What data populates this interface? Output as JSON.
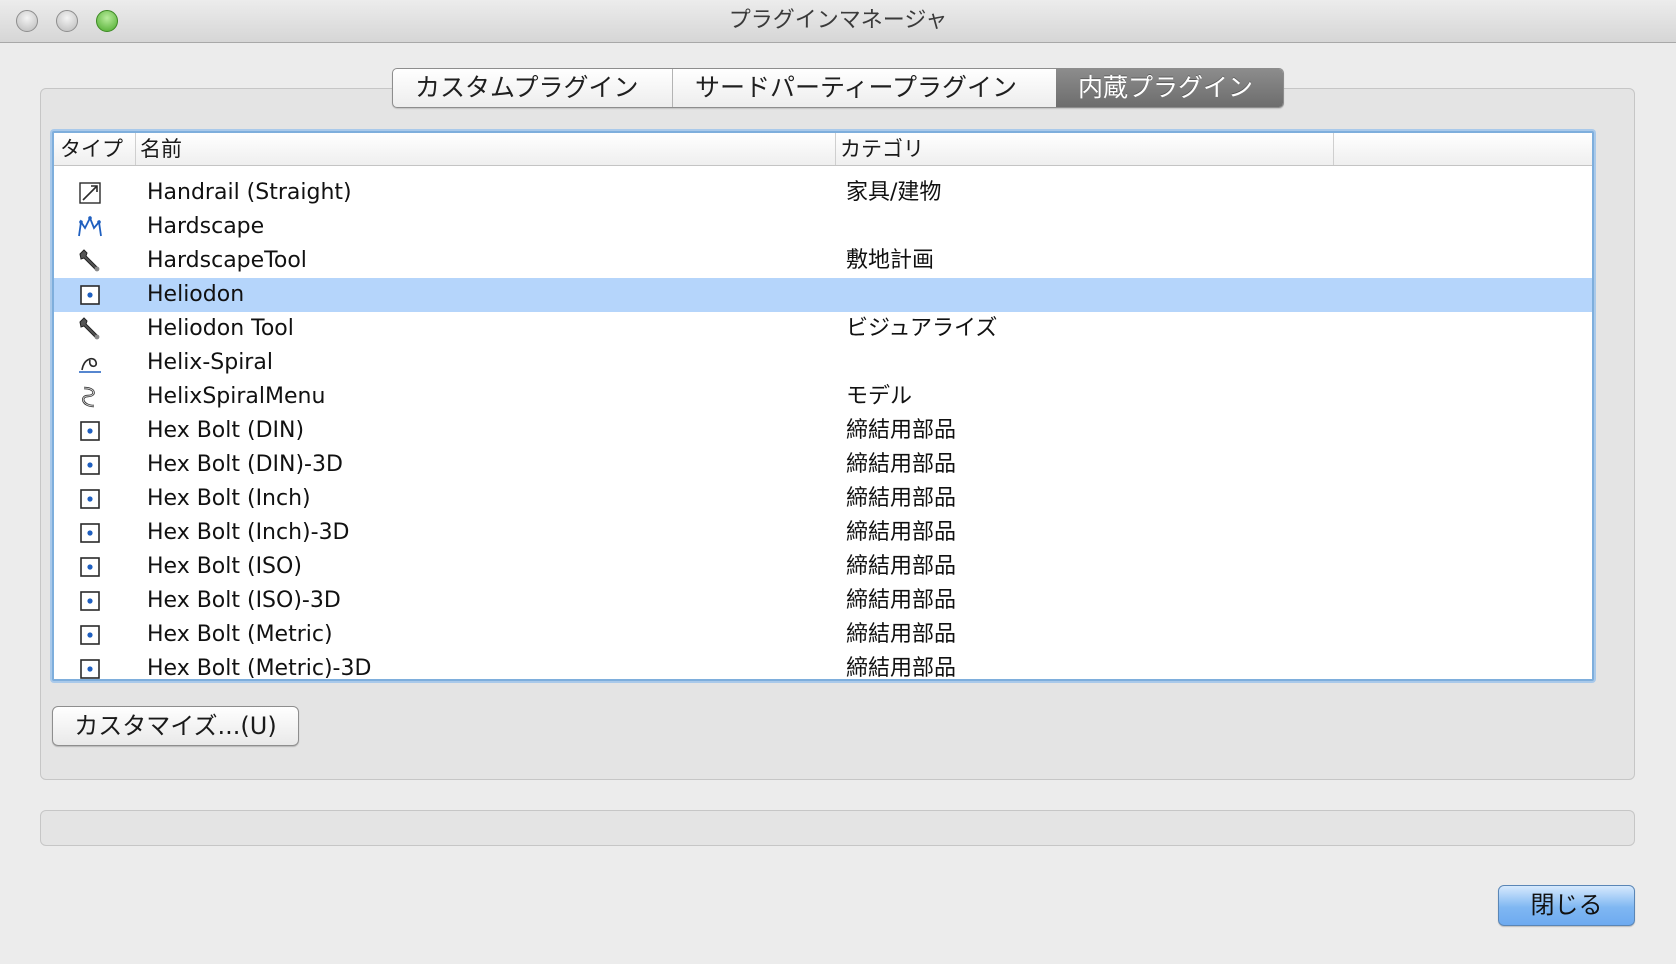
{
  "window": {
    "title": "プラグインマネージャ"
  },
  "tabs": [
    {
      "label": "カスタムプラグイン"
    },
    {
      "label": "サードパーティープラグイン"
    },
    {
      "label": "内蔵プラグイン",
      "selected": true
    }
  ],
  "list": {
    "columns": {
      "type": "タイプ",
      "name": "名前",
      "category": "カテゴリ"
    },
    "rows": [
      {
        "icon": "handrail-icon",
        "name": "Handrail (Straight)",
        "category": "家具/建物"
      },
      {
        "icon": "hardscape-icon",
        "name": "Hardscape",
        "category": ""
      },
      {
        "icon": "wrench-icon",
        "name": "HardscapeTool",
        "category": "敷地計画"
      },
      {
        "icon": "point-object-icon",
        "name": "Heliodon",
        "category": "",
        "selected": true
      },
      {
        "icon": "wrench-icon",
        "name": "Heliodon Tool",
        "category": "ビジュアライズ"
      },
      {
        "icon": "helix-spiral-icon",
        "name": "Helix-Spiral",
        "category": ""
      },
      {
        "icon": "helix-menu-icon",
        "name": "HelixSpiralMenu",
        "category": "モデル"
      },
      {
        "icon": "point-object-icon",
        "name": "Hex Bolt (DIN)",
        "category": "締結用部品"
      },
      {
        "icon": "point-object-icon",
        "name": "Hex Bolt (DIN)-3D",
        "category": "締結用部品"
      },
      {
        "icon": "point-object-icon",
        "name": "Hex Bolt (Inch)",
        "category": "締結用部品"
      },
      {
        "icon": "point-object-icon",
        "name": "Hex Bolt (Inch)-3D",
        "category": "締結用部品"
      },
      {
        "icon": "point-object-icon",
        "name": "Hex Bolt (ISO)",
        "category": "締結用部品"
      },
      {
        "icon": "point-object-icon",
        "name": "Hex Bolt (ISO)-3D",
        "category": "締結用部品"
      },
      {
        "icon": "point-object-icon",
        "name": "Hex Bolt (Metric)",
        "category": "締結用部品"
      },
      {
        "icon": "point-object-icon",
        "name": "Hex Bolt (Metric)-3D",
        "category": "締結用部品"
      }
    ]
  },
  "buttons": {
    "customize": "カスタマイズ...(U)",
    "close": "閉じる"
  },
  "colors": {
    "selection": "#b5d5fb",
    "focus_ring": "#7eaedc",
    "icon_blue": "#1f5fbf"
  }
}
